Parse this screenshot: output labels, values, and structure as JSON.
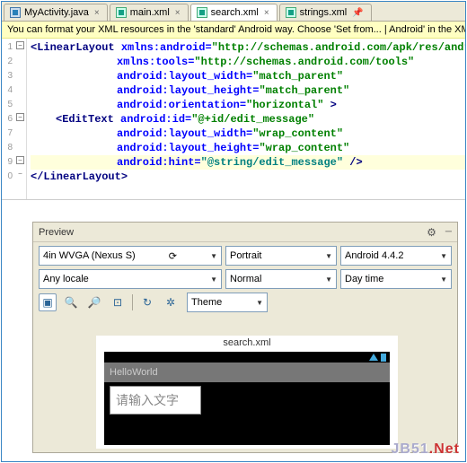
{
  "tabs": [
    {
      "label": "MyActivity.java",
      "type": "c"
    },
    {
      "label": "main.xml",
      "type": "x"
    },
    {
      "label": "search.xml",
      "type": "x",
      "active": true
    },
    {
      "label": "strings.xml",
      "type": "x"
    }
  ],
  "hint": "You can format your XML resources in the 'standard' Android way. Choose 'Set from...  | Android' in the XM",
  "lines": [
    "1",
    "2",
    "3",
    "4",
    "5",
    "6",
    "7",
    "8",
    "9",
    "0"
  ],
  "code": {
    "l1": {
      "tag": "<LinearLayout",
      "attr": " xmlns:android=",
      "val": "\"http://schemas.android.com/apk/res/andr"
    },
    "l2": {
      "attr": "xmlns:tools=",
      "val": "\"http://schemas.android.com/tools\""
    },
    "l3": {
      "attr": "android:layout_width=",
      "val": "\"match_parent\""
    },
    "l4": {
      "attr": "android:layout_height=",
      "val": "\"match_parent\""
    },
    "l5": {
      "attr": "android:orientation=",
      "val": "\"horizontal\"",
      "end": " >"
    },
    "l6": {
      "tag": "<EditText",
      "attr": " android:id=",
      "val": "\"@+id/edit_message\""
    },
    "l7": {
      "attr": "android:layout_width=",
      "val": "\"wrap_content\""
    },
    "l8": {
      "attr": "android:layout_height=",
      "val": "\"wrap_content\""
    },
    "l9": {
      "attr": "android:hint=",
      "val": "\"@string/edit_message\"",
      "end": " />"
    },
    "l10": {
      "tag": "</LinearLayout>"
    }
  },
  "preview": {
    "title": "Preview",
    "device": "4in WVGA (Nexus S)",
    "orient": "Portrait",
    "api": "Android 4.4.2",
    "locale": "Any locale",
    "mode": "Normal",
    "time": "Day time",
    "theme": "Theme",
    "filename": "search.xml",
    "apptitle": "HelloWorld",
    "placeholder": "请输入文字"
  },
  "watermark": {
    "a": "JB51",
    "b": ".Net"
  }
}
